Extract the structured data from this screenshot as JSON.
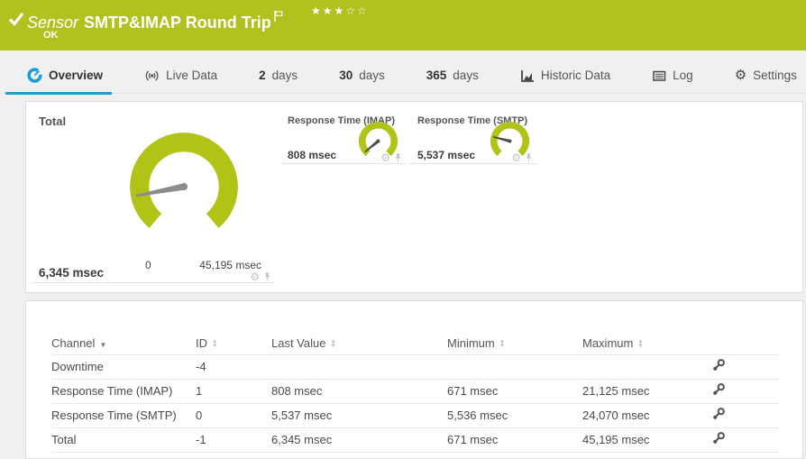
{
  "colors": {
    "status-green": "#b0c120",
    "gauge-green": "#b2c318",
    "accent-blue": "#1b9fd8"
  },
  "header": {
    "type_label": "Sensor",
    "title": "SMTP&IMAP Round Trip",
    "status": "OK",
    "stars_filled": "★★★",
    "stars_empty": "☆☆"
  },
  "tabs": [
    {
      "label": "Overview",
      "active": true
    },
    {
      "label": "Live Data"
    },
    {
      "num": "2",
      "label": "days"
    },
    {
      "num": "30",
      "label": "days"
    },
    {
      "num": "365",
      "label": "days"
    },
    {
      "label": "Historic Data"
    },
    {
      "label": "Log"
    },
    {
      "label": "Settings"
    }
  ],
  "gauges": {
    "total": {
      "label": "Total",
      "value": 6345,
      "min": 0,
      "max": 45195,
      "value_label": "6,345 msec",
      "min_label": "0",
      "max_label": "45,195 msec"
    },
    "imap": {
      "label": "Response Time (IMAP)",
      "value": 808,
      "min": 0,
      "max": 21125,
      "value_label": "808 msec"
    },
    "smtp": {
      "label": "Response Time (SMTP)",
      "value": 5537,
      "min": 0,
      "max": 24070,
      "value_label": "5,537 msec"
    }
  },
  "table": {
    "headers": {
      "channel": "Channel",
      "id": "ID",
      "last": "Last Value",
      "min": "Minimum",
      "max": "Maximum"
    },
    "rows": [
      {
        "channel": "Downtime",
        "id": "-4",
        "last": "",
        "min": "",
        "max": ""
      },
      {
        "channel": "Response Time (IMAP)",
        "id": "1",
        "last": "808 msec",
        "min": "671 msec",
        "max": "21,125 msec"
      },
      {
        "channel": "Response Time (SMTP)",
        "id": "0",
        "last": "5,537 msec",
        "min": "5,536 msec",
        "max": "24,070 msec"
      },
      {
        "channel": "Total",
        "id": "-1",
        "last": "6,345 msec",
        "min": "671 msec",
        "max": "45,195 msec"
      }
    ]
  }
}
